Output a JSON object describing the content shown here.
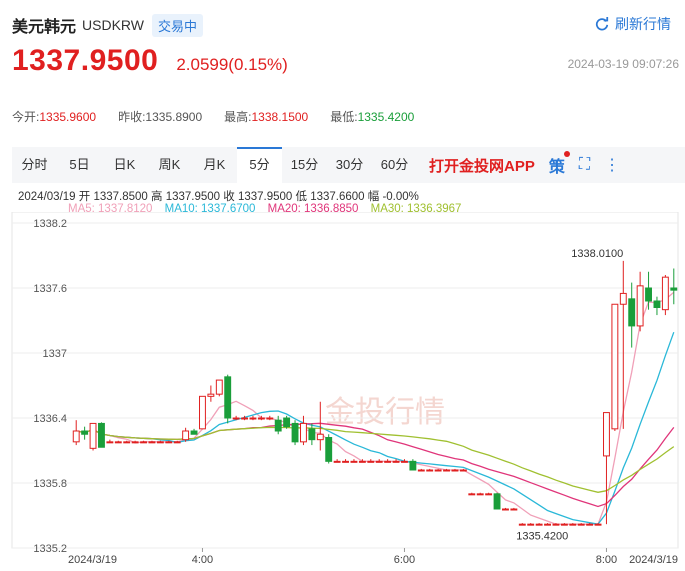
{
  "header": {
    "name": "美元韩元",
    "code": "USDKRW",
    "status": "交易中",
    "refresh_label": "刷新行情"
  },
  "quote": {
    "price": "1337.9500",
    "change": "2.0599(0.15%)",
    "timestamp": "2024-03-19 09:07:26"
  },
  "stats": [
    {
      "label": "今开:",
      "value": "1335.9600",
      "color": "red"
    },
    {
      "label": "昨收:",
      "value": "1335.8900",
      "color": "neutral"
    },
    {
      "label": "最高:",
      "value": "1338.1500",
      "color": "red"
    },
    {
      "label": "最低:",
      "value": "1335.4200",
      "color": "green"
    }
  ],
  "tabs": [
    "分时",
    "5日",
    "日K",
    "周K",
    "月K",
    "5分",
    "15分",
    "30分",
    "60分"
  ],
  "active_tab": "5分",
  "promo": "打开金投网APP",
  "tools": {
    "ce": "策",
    "fullscreen_icon": "fullscreen-icon",
    "more_icon": "more-icon"
  },
  "ohlc_line": "2024/03/19  开 1337.8500  高 1337.9500  收 1337.9500  低 1337.6600  幅 -0.00%",
  "ma_legend": [
    {
      "label": "MA5: 1337.8120",
      "color": "#f0a0b8"
    },
    {
      "label": "MA10: 1337.6700",
      "color": "#2ab8d8"
    },
    {
      "label": "MA20: 1336.8850",
      "color": "#e0357a"
    },
    {
      "label": "MA30: 1336.3967",
      "color": "#a0c030"
    }
  ],
  "watermark": "金投行情",
  "chart_data": {
    "type": "candlestick",
    "y_ticks": [
      "1338.2",
      "1337.6",
      "1337",
      "1336.4",
      "1335.8",
      "1335.2"
    ],
    "ylim": [
      1335.2,
      1338.2
    ],
    "x_ticks": [
      {
        "label": "2024/3/19",
        "index": 0
      },
      {
        "label": "4:00",
        "index": 15
      },
      {
        "label": "6:00",
        "index": 39
      },
      {
        "label": "8:00",
        "index": 63
      },
      {
        "label": "2024/3/19",
        "index": 71
      }
    ],
    "max_label": "1338.0100",
    "min_label": "1335.4200",
    "candles": [
      {
        "o": 1336.18,
        "h": 1336.38,
        "l": 1336.15,
        "c": 1336.28
      },
      {
        "o": 1336.28,
        "h": 1336.32,
        "l": 1336.2,
        "c": 1336.25
      },
      {
        "o": 1336.12,
        "h": 1336.35,
        "l": 1336.1,
        "c": 1336.35
      },
      {
        "o": 1336.35,
        "h": 1336.36,
        "l": 1336.13,
        "c": 1336.13
      },
      {
        "o": 1336.18,
        "h": 1336.2,
        "l": 1336.17,
        "c": 1336.18
      },
      {
        "o": 1336.18,
        "h": 1336.19,
        "l": 1336.17,
        "c": 1336.18
      },
      {
        "o": 1336.18,
        "h": 1336.19,
        "l": 1336.17,
        "c": 1336.18
      },
      {
        "o": 1336.18,
        "h": 1336.19,
        "l": 1336.17,
        "c": 1336.18
      },
      {
        "o": 1336.18,
        "h": 1336.19,
        "l": 1336.17,
        "c": 1336.18
      },
      {
        "o": 1336.18,
        "h": 1336.19,
        "l": 1336.17,
        "c": 1336.18
      },
      {
        "o": 1336.18,
        "h": 1336.19,
        "l": 1336.17,
        "c": 1336.18
      },
      {
        "o": 1336.18,
        "h": 1336.19,
        "l": 1336.17,
        "c": 1336.18
      },
      {
        "o": 1336.18,
        "h": 1336.19,
        "l": 1336.17,
        "c": 1336.18
      },
      {
        "o": 1336.2,
        "h": 1336.31,
        "l": 1336.18,
        "c": 1336.28
      },
      {
        "o": 1336.28,
        "h": 1336.3,
        "l": 1336.25,
        "c": 1336.25
      },
      {
        "o": 1336.3,
        "h": 1336.6,
        "l": 1336.3,
        "c": 1336.6
      },
      {
        "o": 1336.6,
        "h": 1336.7,
        "l": 1336.55,
        "c": 1336.62
      },
      {
        "o": 1336.62,
        "h": 1336.75,
        "l": 1336.6,
        "c": 1336.75
      },
      {
        "o": 1336.78,
        "h": 1336.8,
        "l": 1336.35,
        "c": 1336.4
      },
      {
        "o": 1336.4,
        "h": 1336.42,
        "l": 1336.38,
        "c": 1336.4
      },
      {
        "o": 1336.4,
        "h": 1336.42,
        "l": 1336.38,
        "c": 1336.4
      },
      {
        "o": 1336.4,
        "h": 1336.42,
        "l": 1336.38,
        "c": 1336.4
      },
      {
        "o": 1336.4,
        "h": 1336.42,
        "l": 1336.38,
        "c": 1336.4
      },
      {
        "o": 1336.4,
        "h": 1336.42,
        "l": 1336.38,
        "c": 1336.4
      },
      {
        "o": 1336.38,
        "h": 1336.42,
        "l": 1336.25,
        "c": 1336.28
      },
      {
        "o": 1336.4,
        "h": 1336.42,
        "l": 1336.3,
        "c": 1336.32
      },
      {
        "o": 1336.35,
        "h": 1336.38,
        "l": 1336.15,
        "c": 1336.18
      },
      {
        "o": 1336.18,
        "h": 1336.42,
        "l": 1336.15,
        "c": 1336.35
      },
      {
        "o": 1336.3,
        "h": 1336.35,
        "l": 1336.15,
        "c": 1336.2
      },
      {
        "o": 1336.2,
        "h": 1336.55,
        "l": 1336.1,
        "c": 1336.25
      },
      {
        "o": 1336.22,
        "h": 1336.25,
        "l": 1335.98,
        "c": 1336.0
      },
      {
        "o": 1336.0,
        "h": 1336.02,
        "l": 1335.99,
        "c": 1336.0
      },
      {
        "o": 1336.0,
        "h": 1336.02,
        "l": 1335.99,
        "c": 1336.0
      },
      {
        "o": 1336.0,
        "h": 1336.02,
        "l": 1335.99,
        "c": 1336.0
      },
      {
        "o": 1336.0,
        "h": 1336.02,
        "l": 1335.99,
        "c": 1336.0
      },
      {
        "o": 1336.0,
        "h": 1336.02,
        "l": 1335.99,
        "c": 1336.0
      },
      {
        "o": 1336.0,
        "h": 1336.02,
        "l": 1335.99,
        "c": 1336.0
      },
      {
        "o": 1336.0,
        "h": 1336.02,
        "l": 1335.99,
        "c": 1336.0
      },
      {
        "o": 1336.0,
        "h": 1336.02,
        "l": 1335.99,
        "c": 1336.0
      },
      {
        "o": 1336.0,
        "h": 1336.02,
        "l": 1335.99,
        "c": 1336.0
      },
      {
        "o": 1336.0,
        "h": 1336.02,
        "l": 1335.92,
        "c": 1335.92
      },
      {
        "o": 1335.92,
        "h": 1335.93,
        "l": 1335.91,
        "c": 1335.92
      },
      {
        "o": 1335.92,
        "h": 1335.93,
        "l": 1335.91,
        "c": 1335.92
      },
      {
        "o": 1335.92,
        "h": 1335.93,
        "l": 1335.91,
        "c": 1335.92
      },
      {
        "o": 1335.92,
        "h": 1335.93,
        "l": 1335.91,
        "c": 1335.92
      },
      {
        "o": 1335.92,
        "h": 1335.93,
        "l": 1335.91,
        "c": 1335.92
      },
      {
        "o": 1335.92,
        "h": 1335.93,
        "l": 1335.91,
        "c": 1335.92
      },
      {
        "o": 1335.7,
        "h": 1335.71,
        "l": 1335.69,
        "c": 1335.7
      },
      {
        "o": 1335.7,
        "h": 1335.71,
        "l": 1335.69,
        "c": 1335.7
      },
      {
        "o": 1335.7,
        "h": 1335.71,
        "l": 1335.69,
        "c": 1335.7
      },
      {
        "o": 1335.7,
        "h": 1335.71,
        "l": 1335.56,
        "c": 1335.56
      },
      {
        "o": 1335.56,
        "h": 1335.57,
        "l": 1335.55,
        "c": 1335.56
      },
      {
        "o": 1335.56,
        "h": 1335.57,
        "l": 1335.55,
        "c": 1335.56
      },
      {
        "o": 1335.42,
        "h": 1335.43,
        "l": 1335.41,
        "c": 1335.42
      },
      {
        "o": 1335.42,
        "h": 1335.43,
        "l": 1335.41,
        "c": 1335.42
      },
      {
        "o": 1335.42,
        "h": 1335.43,
        "l": 1335.41,
        "c": 1335.42
      },
      {
        "o": 1335.42,
        "h": 1335.43,
        "l": 1335.41,
        "c": 1335.42
      },
      {
        "o": 1335.42,
        "h": 1335.43,
        "l": 1335.41,
        "c": 1335.42
      },
      {
        "o": 1335.42,
        "h": 1335.43,
        "l": 1335.41,
        "c": 1335.42
      },
      {
        "o": 1335.42,
        "h": 1335.43,
        "l": 1335.41,
        "c": 1335.42
      },
      {
        "o": 1335.42,
        "h": 1335.43,
        "l": 1335.41,
        "c": 1335.42
      },
      {
        "o": 1335.42,
        "h": 1335.43,
        "l": 1335.41,
        "c": 1335.42
      },
      {
        "o": 1335.42,
        "h": 1335.43,
        "l": 1335.41,
        "c": 1335.42
      },
      {
        "o": 1336.05,
        "h": 1336.45,
        "l": 1335.42,
        "c": 1336.45
      },
      {
        "o": 1336.3,
        "h": 1337.45,
        "l": 1336.28,
        "c": 1337.45
      },
      {
        "o": 1337.45,
        "h": 1337.85,
        "l": 1336.3,
        "c": 1337.55
      },
      {
        "o": 1337.5,
        "h": 1337.65,
        "l": 1337.05,
        "c": 1337.25
      },
      {
        "o": 1337.25,
        "h": 1337.75,
        "l": 1337.2,
        "c": 1337.62
      },
      {
        "o": 1337.6,
        "h": 1337.75,
        "l": 1337.4,
        "c": 1337.48
      },
      {
        "o": 1337.48,
        "h": 1337.52,
        "l": 1337.35,
        "c": 1337.42
      },
      {
        "o": 1337.4,
        "h": 1337.72,
        "l": 1337.35,
        "c": 1337.7
      },
      {
        "o": 1337.6,
        "h": 1337.78,
        "l": 1337.45,
        "c": 1337.58
      }
    ]
  }
}
